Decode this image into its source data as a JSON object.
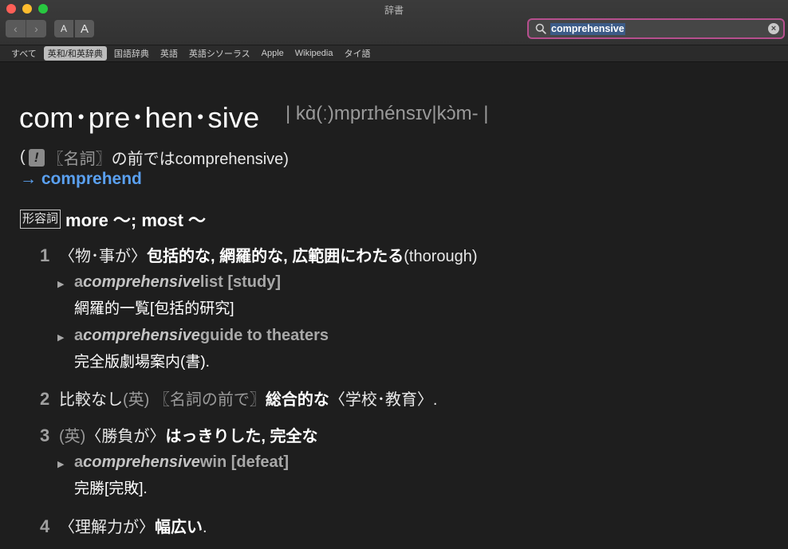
{
  "window": {
    "title": "辞書"
  },
  "toolbar": {
    "back_glyph": "‹",
    "forward_glyph": "›",
    "font_small_label": "A",
    "font_large_label": "A"
  },
  "search": {
    "value": "comprehensive",
    "clear_glyph": "×"
  },
  "tabs": [
    {
      "label": "すべて",
      "active": false
    },
    {
      "label": "英和/和英辞典",
      "active": true
    },
    {
      "label": "国語辞典",
      "active": false
    },
    {
      "label": "英語",
      "active": false
    },
    {
      "label": "英語シソーラス",
      "active": false
    },
    {
      "label": "Apple",
      "active": false
    },
    {
      "label": "Wikipedia",
      "active": false
    },
    {
      "label": "タイ語",
      "active": false
    }
  ],
  "entry": {
    "headword": "com･pre･hen･sive",
    "pronunciation": "| kɑ̀(ː)mprɪhénsɪv|kɔ̀m- |",
    "note_open": "(",
    "note_bang": "!",
    "note_bracket": "〖名詞〗",
    "note_rest": "の前ではcomprehensive)",
    "xref": "→ comprehend",
    "pos": "形容詞",
    "forms": "more 〜; most 〜",
    "senses": [
      {
        "num": "1",
        "parts": {
          "a": "〈物･事が〉",
          "b": "包括的な, 網羅的な, 広範囲にわたる",
          "c": "(thorough)"
        }
      },
      {
        "num": "2",
        "parts": {
          "a": "比較なし ",
          "g": "(英) 〖名詞の前で〗",
          "b": "総合的な",
          "c": "〈学校･教育〉."
        }
      },
      {
        "num": "3",
        "parts": {
          "g": "(英) ",
          "a": "〈勝負が〉",
          "b": "はっきりした, 完全な"
        }
      },
      {
        "num": "4",
        "parts": {
          "a": "〈理解力が〉",
          "b": "幅広い",
          "c": "."
        }
      }
    ],
    "examples": [
      {
        "pre": "a ",
        "word": "comprehensive",
        "post": " list [study]",
        "ja": "網羅的一覧[包括的研究]"
      },
      {
        "pre": "a ",
        "word": "comprehensive",
        "post": " guide to theaters",
        "ja": "完全版劇場案内(書)."
      },
      {
        "pre": "a ",
        "word": "comprehensive",
        "post": " win [defeat]",
        "ja": "完勝[完敗]."
      }
    ]
  }
}
